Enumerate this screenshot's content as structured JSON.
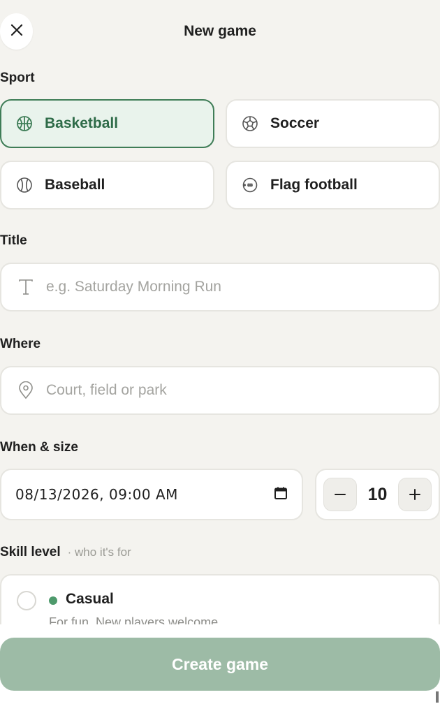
{
  "header": {
    "title": "New game",
    "close_icon": "close-icon"
  },
  "sport": {
    "label": "Sport",
    "options": [
      {
        "label": "Basketball",
        "icon": "basketball-icon",
        "selected": true
      },
      {
        "label": "Soccer",
        "icon": "soccer-ball-icon",
        "selected": false
      },
      {
        "label": "Baseball",
        "icon": "baseball-icon",
        "selected": false
      },
      {
        "label": "Flag football",
        "icon": "football-icon",
        "selected": false
      }
    ]
  },
  "title_field": {
    "label": "Title",
    "placeholder": "e.g. Saturday Morning Run",
    "icon": "text-icon"
  },
  "where_field": {
    "label": "Where",
    "placeholder": "Court, field or park",
    "icon": "location-pin-icon"
  },
  "when_size": {
    "label": "When & size",
    "datetime": "08/13/2026, 09:00 AM",
    "calendar_icon": "calendar-icon",
    "player_count": "10",
    "decrement_label": "−",
    "increment_label": "+"
  },
  "skill": {
    "label": "Skill level",
    "sublabel": "· who it's for",
    "options": [
      {
        "name": "Casual",
        "description": "For fun. New players welcome.",
        "selected": false
      }
    ]
  },
  "footer": {
    "create_label": "Create game"
  },
  "colors": {
    "accent": "#3f7d57",
    "selected_bg": "#e9f3ec",
    "button_disabled": "#9dbba6",
    "casual_dot": "#4e9a6c",
    "background": "#f4f3ef"
  }
}
